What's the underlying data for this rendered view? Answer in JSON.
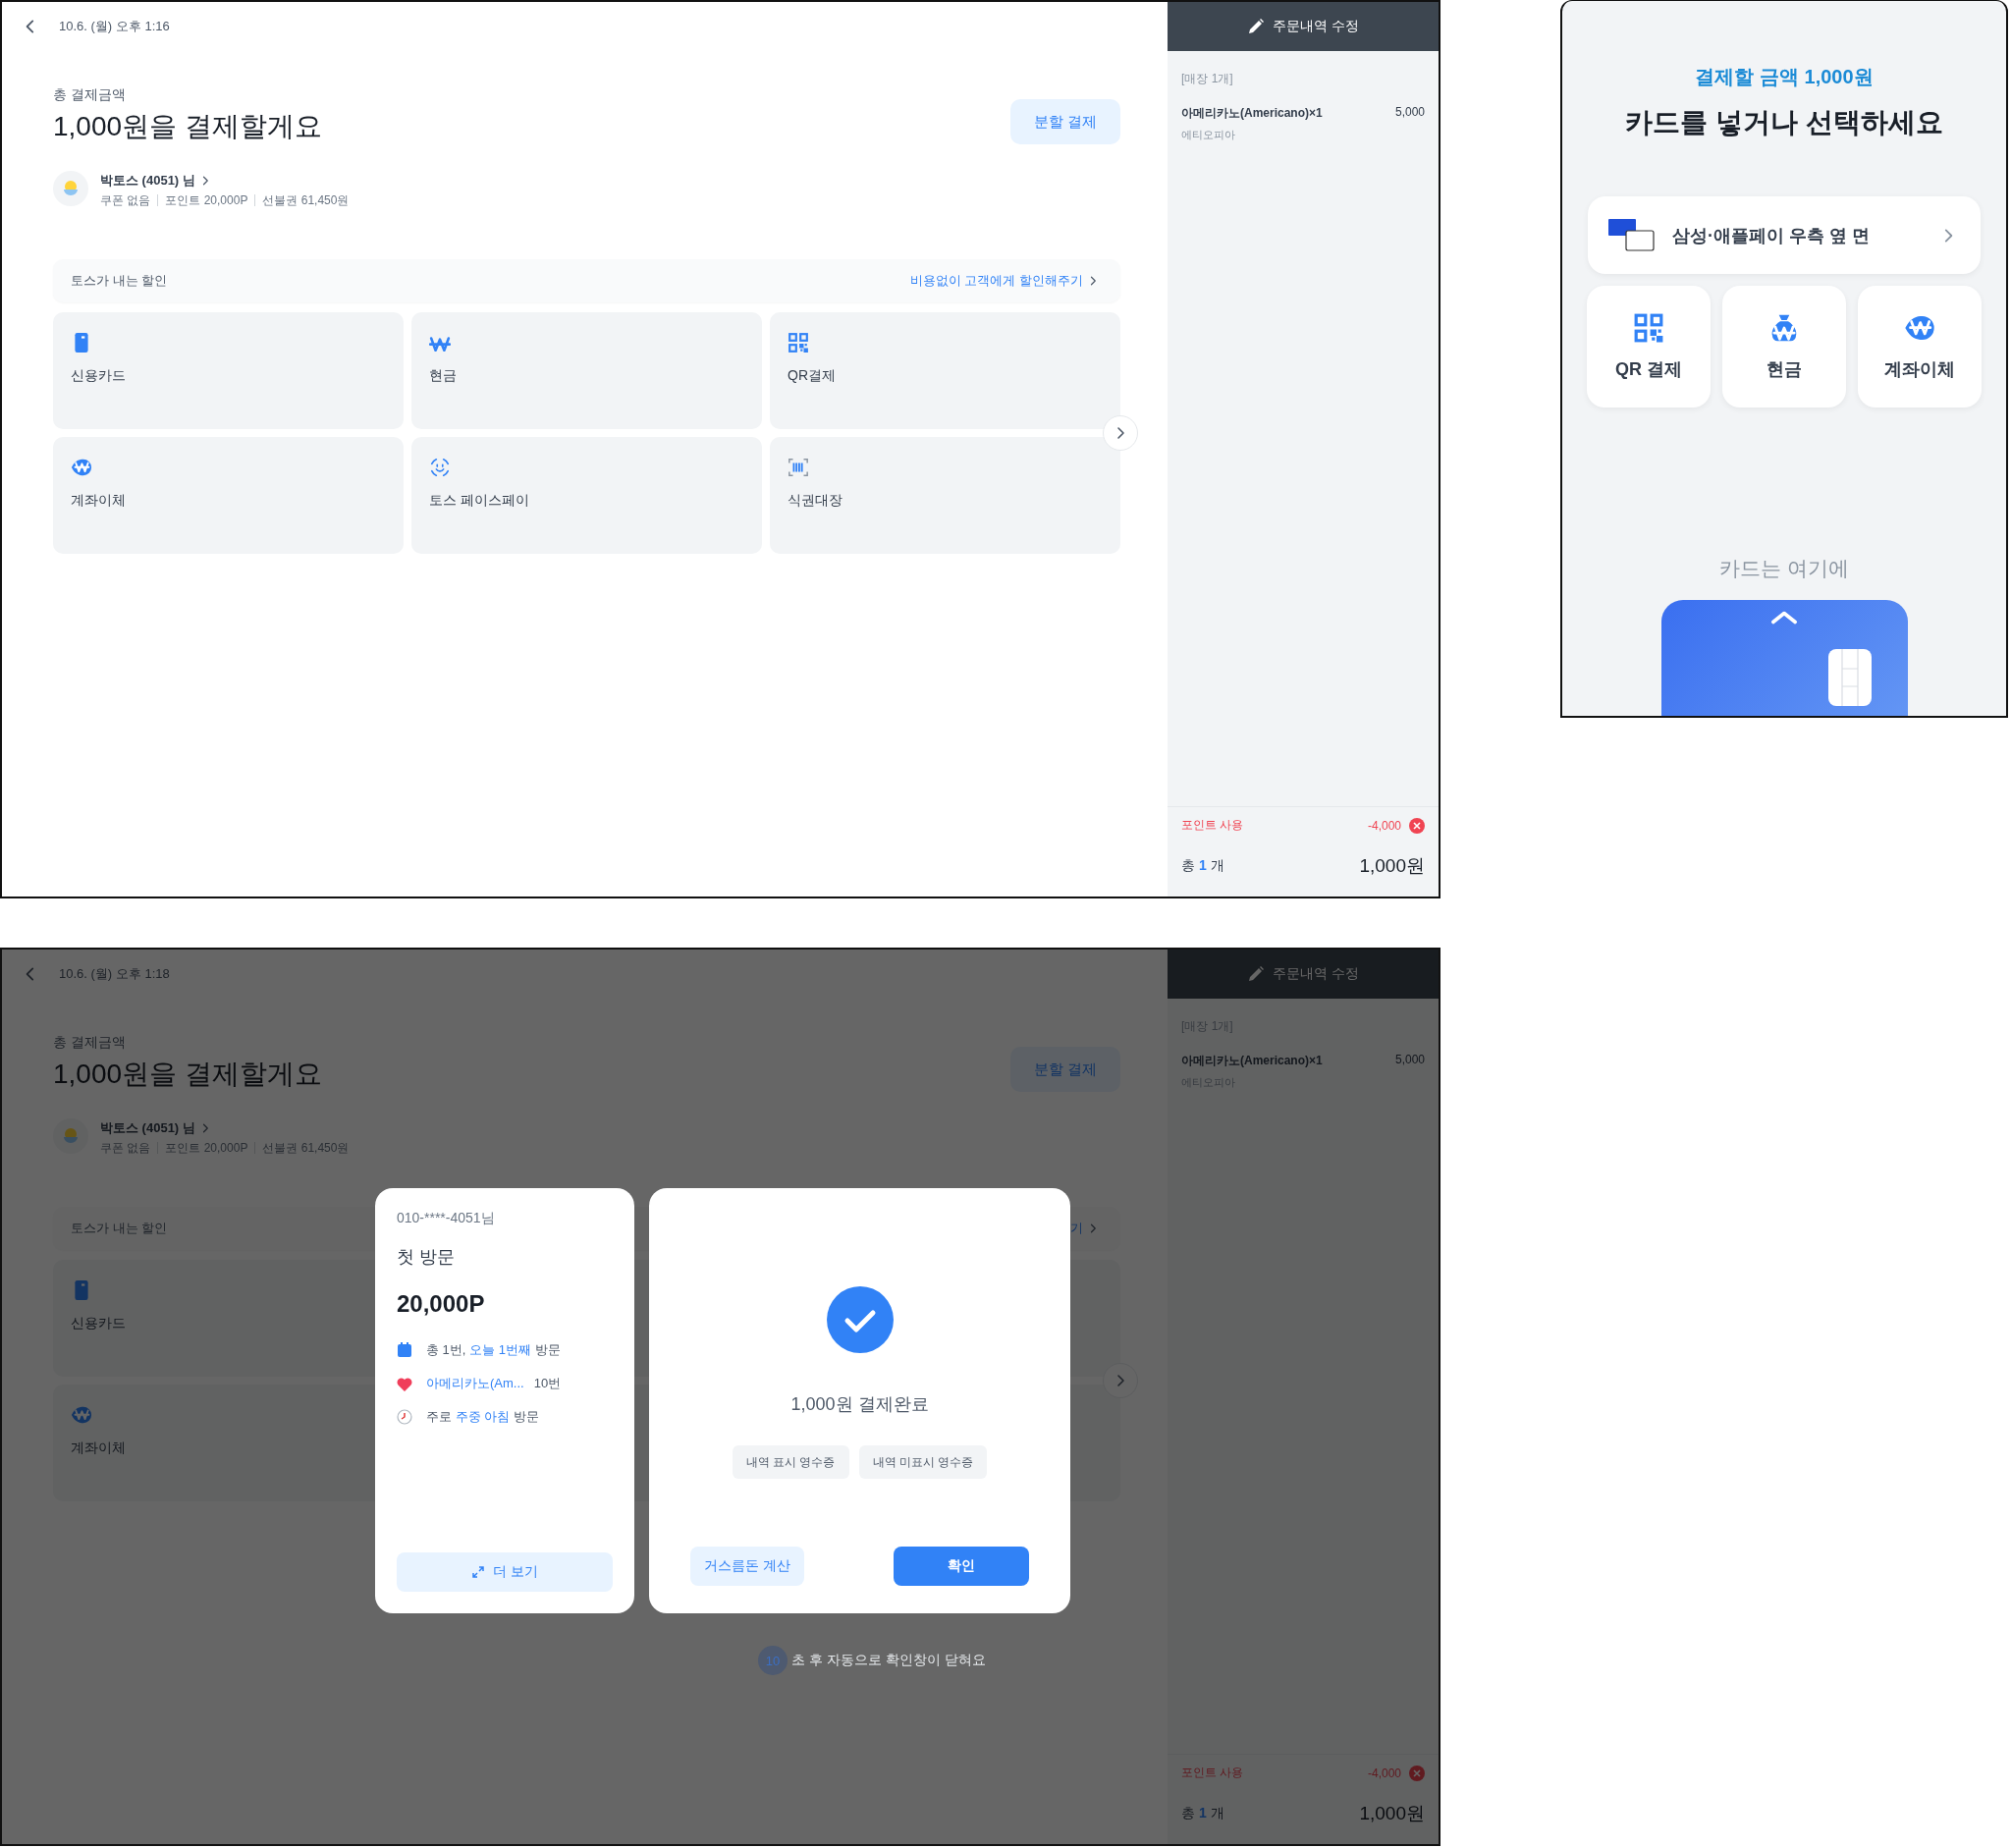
{
  "screens": [
    {
      "header": {
        "time": "10.6. (월) 오후 1:16"
      },
      "total_label": "총 결제금액",
      "title": "1,000원을 결제할게요",
      "split_button": "분할 결제",
      "customer": {
        "name": "박토스 (4051) 님",
        "chips": [
          "쿠폰 없음",
          "포인트 20,000P",
          "선불권 61,450원"
        ]
      },
      "discount": {
        "label": "토스가 내는 할인",
        "link": "비용없이 고객에게 할인해주기"
      },
      "tiles": [
        {
          "kind": "card",
          "label": "신용카드"
        },
        {
          "kind": "cash",
          "label": "현금"
        },
        {
          "kind": "qr",
          "label": "QR결제"
        },
        {
          "kind": "transfer",
          "label": "계좌이체"
        },
        {
          "kind": "face",
          "label": "토스 페이스페이"
        },
        {
          "kind": "voucher",
          "label": "식권대장"
        }
      ],
      "sidebar": {
        "edit_button": "주문내역 수정",
        "section": "[매장 1개]",
        "items": [
          {
            "name": "아메리카노(Americano)×1",
            "price": "5,000",
            "option": "에티오피아"
          }
        ],
        "points": {
          "label": "포인트 사용",
          "amount": "-4,000"
        },
        "total": {
          "label": "총",
          "count": "1",
          "unit": "개",
          "amount": "1,000원"
        }
      }
    },
    {
      "header": {
        "time": "10.6. (월) 오후 1:18"
      },
      "total_label": "총 결제금액",
      "title": "1,000원을 결제할게요",
      "split_button": "분할 결제",
      "customer": {
        "name": "박토스 (4051) 님",
        "chips": [
          "쿠폰 없음",
          "포인트 20,000P",
          "선불권 61,450원"
        ]
      },
      "discount": {
        "label": "토스가 내는 할인",
        "link": "기"
      },
      "tiles": [
        {
          "kind": "card",
          "label": "신용카드"
        },
        {
          "kind": "covered"
        },
        {
          "kind": "covered"
        },
        {
          "kind": "transfer",
          "label": "계좌이체"
        },
        {
          "kind": "covered"
        },
        {
          "kind": "covered"
        }
      ],
      "sidebar": {
        "edit_button": "주문내역 수정",
        "section": "[매장 1개]",
        "items": [
          {
            "name": "아메리카노(Americano)×1",
            "price": "5,000",
            "option": "에티오피아"
          }
        ],
        "points": {
          "label": "포인트 사용",
          "amount": "-4,000"
        },
        "total": {
          "label": "총",
          "count": "1",
          "unit": "개",
          "amount": "1,000원"
        }
      },
      "dialog": {
        "customer_card": {
          "phone": "010-****-4051님",
          "visit": "첫 방문",
          "points": "20,000P",
          "facts": [
            {
              "kind": "calendar",
              "text": "총 1번, **오늘 1번째** 방문"
            },
            {
              "kind": "heart",
              "text": "아메리카노(Am...",
              "count": "10번"
            },
            {
              "kind": "clock",
              "text": "주로 **주중 아침** 방문"
            }
          ],
          "more_button": "더 보기"
        },
        "result": {
          "title": "1,000원 결제완료",
          "receipts": [
            "내역 표시 영수증",
            "내역 미표시 영수증"
          ],
          "change_button": "거스름돈 계산",
          "confirm_button": "확인"
        },
        "countdown": {
          "seconds": "10",
          "text": "초 후 자동으로 확인창이 닫혀요"
        }
      }
    }
  ],
  "customer_display": {
    "amount": "결제할 금액 1,000원",
    "title": "카드를 넣거나 선택하세요",
    "wallet": "삼성·애플페이 우측 옆 면",
    "options": [
      {
        "kind": "qr",
        "label": "QR 결제"
      },
      {
        "kind": "bag",
        "label": "현금"
      },
      {
        "kind": "transfer",
        "label": "계좌이체"
      }
    ],
    "card_hint": "카드는 여기에"
  }
}
